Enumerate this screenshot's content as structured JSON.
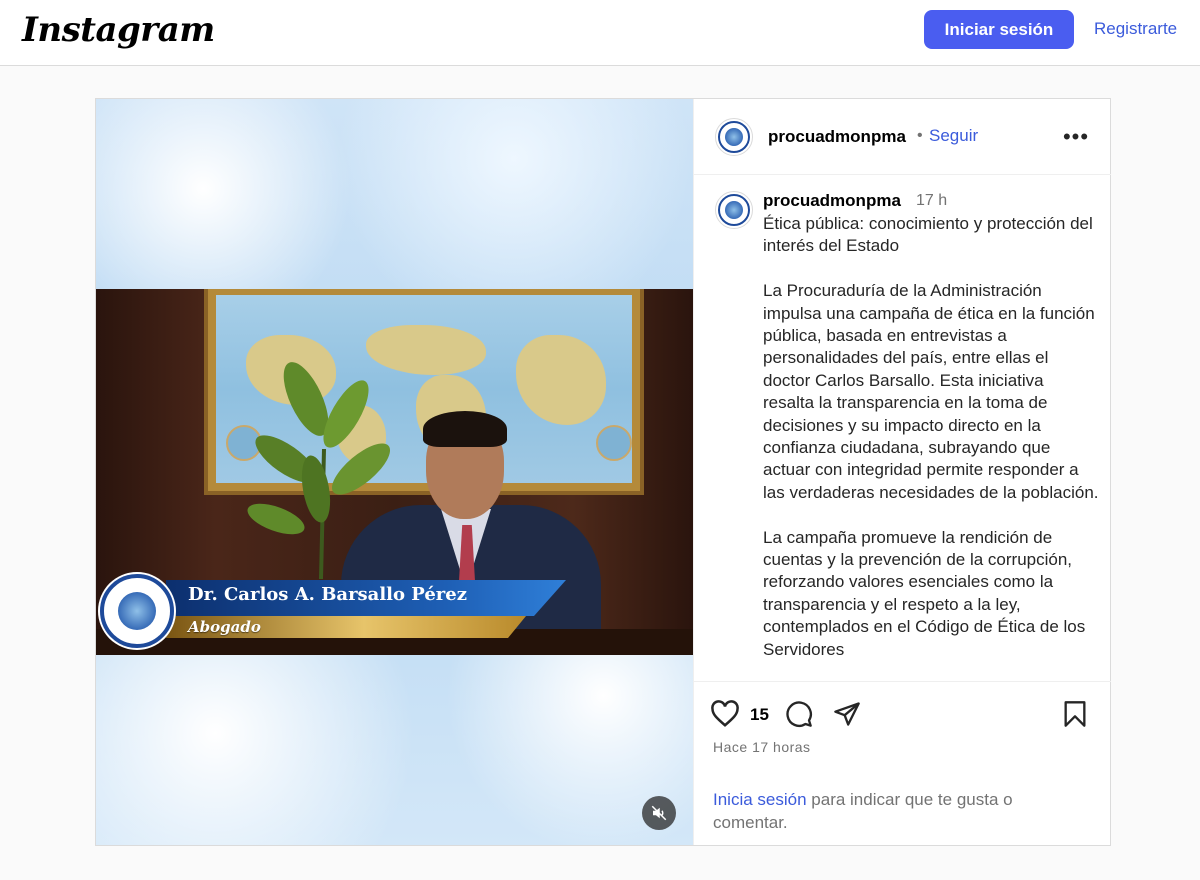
{
  "header": {
    "logo_text": "Instagram",
    "login_label": "Iniciar sesión",
    "register_label": "Registrarte"
  },
  "post": {
    "username": "procuadmonpma",
    "follow_label": "Seguir",
    "separator": "•",
    "more_label": "•••",
    "time_short": "17 h",
    "video": {
      "lower_third_name": "Dr. Carlos A. Barsallo Pérez",
      "lower_third_role": "Abogado"
    },
    "caption": {
      "title": "Ética pública: conocimiento y protección del interés del Estado",
      "paragraph1": "La Procuraduría de la Administración impulsa una campaña de ética en la función pública, basada en entrevistas a personalidades del país, entre ellas el doctor Carlos Barsallo. Esta iniciativa resalta la transparencia en la toma de decisiones y su impacto directo en la confianza ciudadana, subrayando que actuar con integridad permite responder a las verdaderas necesidades de la población.",
      "paragraph2": "La campaña promueve la rendición de cuentas y la prevención de la corrupción, reforzando valores esenciales como la transparencia y el respeto a la ley, contemplados en el Código de Ética de los Servidores"
    },
    "likes_count": "15",
    "posted_ago": "Hace 17 horas",
    "login_cta_link": "Inicia sesión",
    "login_cta_rest": " para indicar que te gusta o comentar."
  },
  "icons": {
    "like": "heart-icon",
    "comment": "comment-icon",
    "share": "paper-plane-icon",
    "save": "bookmark-icon",
    "mute": "speaker-muted-icon"
  }
}
